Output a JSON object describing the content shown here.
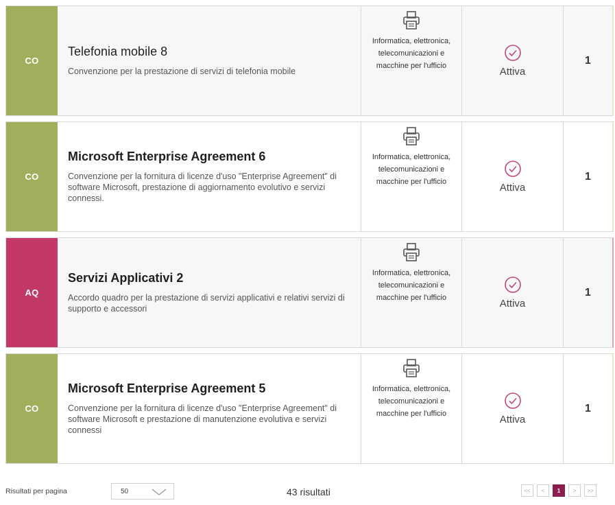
{
  "cards": [
    {
      "tag": "CO",
      "title": "Telefonia mobile 8",
      "description": "Convenzione per la prestazione di servizi di telefonia mobile",
      "category": "Informatica, elettronica, telecomunicazioni e macchine per l'ufficio",
      "category_icon": "printer-icon",
      "status": "Attiva",
      "status_icon": "check-circle-icon",
      "count": "1"
    },
    {
      "tag": "CO",
      "title": "Microsoft Enterprise Agreement 6",
      "description": "Convenzione per la fornitura di licenze d'uso \"Enterprise Agreement\" di software Microsoft, prestazione di aggiornamento evolutivo e servizi connessi.",
      "category": "Informatica, elettronica, telecomunicazioni e macchine per l'ufficio",
      "category_icon": "printer-icon",
      "status": "Attiva",
      "status_icon": "check-circle-icon",
      "count": "1"
    },
    {
      "tag": "AQ",
      "title": "Servizi Applicativi 2",
      "description": "Accordo quadro per la prestazione di servizi applicativi e relativi servizi di supporto e accessori",
      "category": "Informatica, elettronica, telecomunicazioni e macchine per l'ufficio",
      "category_icon": "printer-icon",
      "status": "Attiva",
      "status_icon": "check-circle-icon",
      "count": "1"
    },
    {
      "tag": "CO",
      "title": "Microsoft Enterprise Agreement 5",
      "description": "Convenzione per la fornitura di licenze d'uso \"Enterprise Agreement\" di software Microsoft e prestazione di manutenzione evolutiva e servizi connessi",
      "category": "Informatica, elettronica, telecomunicazioni e macchine per l'ufficio",
      "category_icon": "printer-icon",
      "status": "Attiva",
      "status_icon": "check-circle-icon",
      "count": "1"
    }
  ],
  "footer": {
    "per_page_label": "Risultati per pagina",
    "per_page_value": "50",
    "results_text": "43 risultati",
    "pager": {
      "first": "<<",
      "prev": "<",
      "current": "1",
      "next": ">",
      "last": ">>"
    }
  },
  "colors": {
    "co": "#a3ae5d",
    "aq": "#c23866",
    "check": "#c2467a",
    "page_active": "#8b1d4f"
  }
}
